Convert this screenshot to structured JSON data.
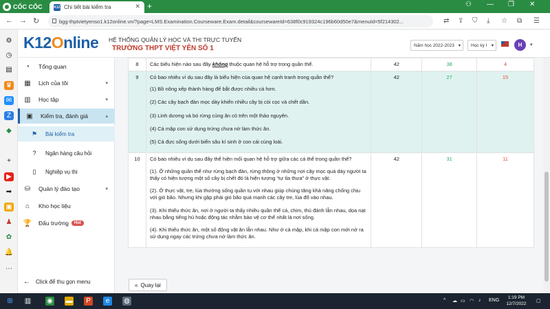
{
  "browser": {
    "brand": "CỐC CỐC",
    "tab_title": "Chi tiết bài kiểm tra",
    "tab_favicon": "K12",
    "url": "bgg-thptvietyenso1.k12online.vn/?page=LMS.Examination.Courseware.Exam.detail&coursewareId=638f0c919324c196b60d50e7&menuId=5f214302..."
  },
  "header": {
    "logo_left": "K12",
    "logo_right": "nline",
    "system_title": "HỆ THỐNG QUẢN LÝ HỌC VÀ THI TRỰC TUYẾN",
    "school_name": "TRƯỜNG THPT VIỆT YÊN SỐ 1",
    "year_select": "Năm học 2022-2023",
    "term_select": "Học kỳ I",
    "avatar_initial": "H"
  },
  "sidebar": {
    "items": [
      {
        "label": "Tổng quan",
        "icon": "dashboard-icon"
      },
      {
        "label": "Lịch của tôi",
        "icon": "calendar-icon"
      },
      {
        "label": "Học tập",
        "icon": "book-icon"
      },
      {
        "label": "Kiểm tra, đánh giá",
        "icon": "exam-icon"
      }
    ],
    "sub_items": [
      {
        "label": "Bài kiểm tra",
        "icon": "flag-icon"
      },
      {
        "label": "Ngân hàng câu hỏi",
        "icon": "question-icon"
      },
      {
        "label": "Nghiệp vụ thi",
        "icon": "clipboard-icon"
      }
    ],
    "items_after": [
      {
        "label": "Quản lý đào tạo",
        "icon": "training-icon"
      },
      {
        "label": "Kho học liệu",
        "icon": "library-icon"
      },
      {
        "label": "Đấu trường",
        "icon": "trophy-icon"
      }
    ],
    "hot_badge": "Hot",
    "collapse_label": "Click để thu gọn menu"
  },
  "questions": [
    {
      "num": "8",
      "text_before": "Các biểu hiện nào sau đây ",
      "text_emph": "không",
      "text_after": " thuộc quan hệ hỗ trợ trong quần thể.",
      "total": "42",
      "correct": "38",
      "wrong": "4"
    },
    {
      "num": "9",
      "text": "Có bao nhiêu ví dụ sau đây là biểu hiện của quan hệ cạnh tranh trong quần thể?",
      "options": [
        "(1) Bồ nông xếp thành hàng để bắt được nhiều cá hơn.",
        "(2) Các cây bạch đàn mọc dày khiến nhiều cây bị còi cọc và chết dần.",
        "(3) Linh dương và bò rừng cùng ăn cỏ trên một thảo nguyên.",
        "(4) Cá mập con sử dụng trứng chưa nở làm thức ăn.",
        "(5) Cá đực sống dưới biển sâu kí sinh ở con cái cùng loài."
      ],
      "total": "42",
      "correct": "27",
      "wrong": "15"
    },
    {
      "num": "10",
      "text": "Có bao nhiêu ví dụ sau đây thể hiện mối quan hệ hỗ trợ giữa các cá thể trong quần thể?",
      "options": [
        "(1). Ở những quần thể như rừng bạch đàn, rừng thông ở những nơi cây mọc quá dày người ta thấy có hiện tượng một số cây bị chết đó là hiện tượng “tự tỉa thưa” ở thực vật.",
        "(2). Ở thực vật, tre, lúa thường sống quần tụ với nhau giúp chúng tăng khả năng chống chịu với gió bão. Nhưng khi gặp phải gió bão quá mạnh các cây tre, lúa đổ vào nhau.",
        "(3). Khi thiếu thức ăn, nơi ở người ta thấy nhiều quần thể cá, chim, thú đánh lẫn nhau, dọa nạt nhau bằng tiếng hú hoặc động tác nhằm bảo vệ cơ thể nhất là nơi sống.",
        "(4). Khi thiếu thức ăn, một số động vật ăn lẫn nhau. Như ở cá mập, khi cá mập con mới nở ra sử dụng ngay các trứng chưa nở làm thức ăn."
      ],
      "total": "42",
      "correct": "31",
      "wrong": "11"
    }
  ],
  "back_button": "Quay lại",
  "taskbar": {
    "language": "ENG",
    "time": "1:19 PM",
    "date": "12/7/2022"
  },
  "colors": {
    "brand_green": "#2a8c43",
    "primary_blue": "#1f5fa8",
    "school_red": "#c0392b",
    "highlight_row": "#dff2ef",
    "correct_green": "#27ae60",
    "wrong_red": "#e74c3c"
  }
}
